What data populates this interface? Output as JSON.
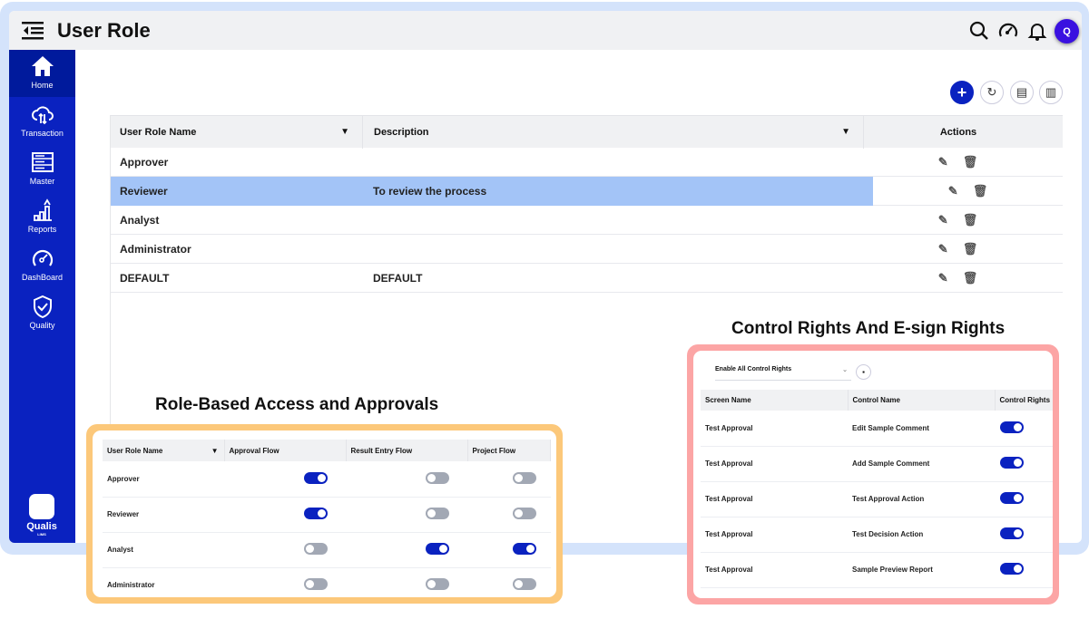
{
  "header": {
    "title": "User Role",
    "avatar_initial": "Q"
  },
  "sidebar": {
    "items": [
      {
        "label": "Home",
        "icon": "home-icon"
      },
      {
        "label": "Transaction",
        "icon": "cloud-transfer-icon"
      },
      {
        "label": "Master",
        "icon": "server-icon"
      },
      {
        "label": "Reports",
        "icon": "chart-growth-icon"
      },
      {
        "label": "DashBoard",
        "icon": "gauge-icon"
      },
      {
        "label": "Quality",
        "icon": "shield-check-icon"
      }
    ],
    "logo": "Qualis",
    "logo_sub": "LIMS"
  },
  "grid": {
    "columns": [
      "User Role Name",
      "Description",
      "Actions"
    ],
    "rows": [
      {
        "name": "Approver",
        "description": ""
      },
      {
        "name": "Reviewer",
        "description": "To review the process",
        "selected": true
      },
      {
        "name": "Analyst",
        "description": ""
      },
      {
        "name": "Administrator",
        "description": ""
      },
      {
        "name": "DEFAULT",
        "description": "DEFAULT"
      }
    ]
  },
  "annotations": {
    "left": "Role-Based Access and Approvals",
    "right": "Control Rights And E-sign Rights"
  },
  "flow_card": {
    "columns": [
      "User Role Name",
      "Approval Flow",
      "Result Entry Flow",
      "Project Flow"
    ],
    "rows": [
      {
        "name": "Approver",
        "flags": [
          true,
          false,
          false
        ]
      },
      {
        "name": "Reviewer",
        "flags": [
          true,
          false,
          false
        ]
      },
      {
        "name": "Analyst",
        "flags": [
          false,
          true,
          true
        ]
      },
      {
        "name": "Administrator",
        "flags": [
          false,
          false,
          false
        ]
      }
    ]
  },
  "rights_card": {
    "dropdown": "Enable All Control Rights",
    "columns": [
      "Screen Name",
      "Control Name",
      "Control Rights"
    ],
    "rows": [
      {
        "screen": "Test Approval",
        "control": "Edit Sample Comment",
        "on": true
      },
      {
        "screen": "Test Approval",
        "control": "Add Sample Comment",
        "on": true
      },
      {
        "screen": "Test Approval",
        "control": "Test Approval Action",
        "on": true
      },
      {
        "screen": "Test Approval",
        "control": "Test Decision Action",
        "on": true
      },
      {
        "screen": "Test Approval",
        "control": "Sample Preview Report",
        "on": true
      }
    ]
  },
  "colors": {
    "primary": "#0a22c0",
    "selected_row": "#a3c4f7",
    "orange_frame": "#fcc87a",
    "pink_frame": "#fca5a5"
  }
}
